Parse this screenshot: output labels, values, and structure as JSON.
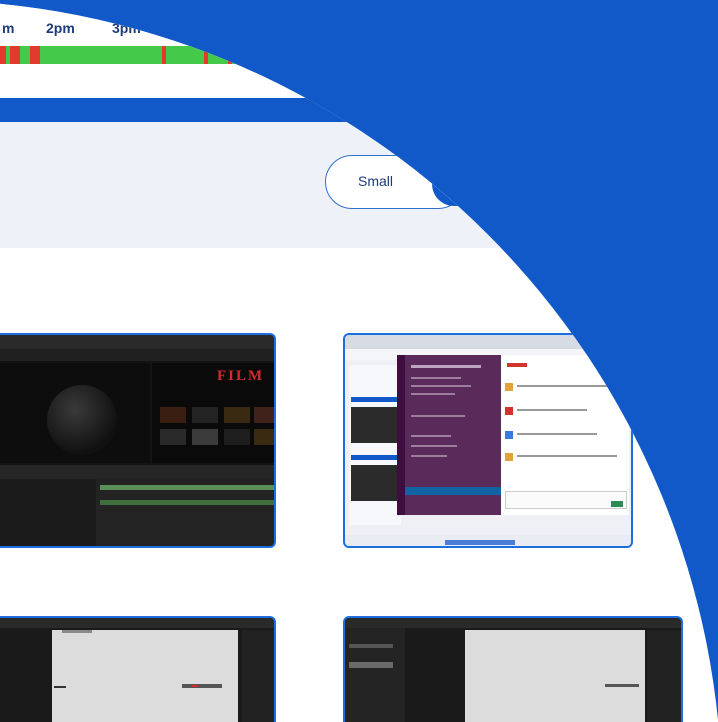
{
  "timeline": {
    "labels": [
      "m",
      "2pm",
      "3pm"
    ],
    "colors": {
      "active": "#45c94b",
      "idle": "#e23a2d",
      "brand": "#1159c9"
    }
  },
  "filter": {
    "size_label": "Small"
  },
  "screenshots": [
    {
      "name": "after-effects-screenshot",
      "film_text": "FILM"
    },
    {
      "name": "slack-window-screenshot"
    },
    {
      "name": "after-effects-canvas-screenshot-1"
    },
    {
      "name": "after-effects-canvas-screenshot-2"
    }
  ]
}
